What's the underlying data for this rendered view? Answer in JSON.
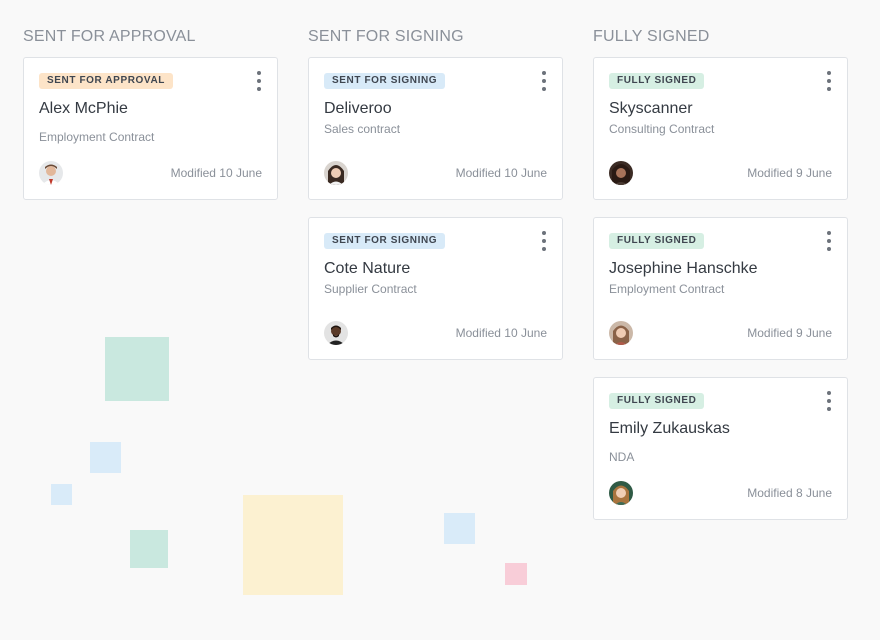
{
  "columns": [
    {
      "title": "SENT FOR APPROVAL",
      "cards": [
        {
          "status": "SENT FOR APPROVAL",
          "name": "Alex McPhie",
          "type": "Employment Contract",
          "modified": "Modified 10 June"
        }
      ]
    },
    {
      "title": "SENT FOR SIGNING",
      "cards": [
        {
          "status": "SENT FOR SIGNING",
          "name": "Deliveroo",
          "type": "Sales contract",
          "modified": "Modified 10 June"
        },
        {
          "status": "SENT FOR SIGNING",
          "name": "Cote Nature",
          "type": "Supplier Contract",
          "modified": "Modified 10 June"
        }
      ]
    },
    {
      "title": "FULLY SIGNED",
      "cards": [
        {
          "status": "FULLY SIGNED",
          "name": "Skyscanner",
          "type": "Consulting Contract",
          "modified": "Modified 9 June"
        },
        {
          "status": "FULLY SIGNED",
          "name": "Josephine Hanschke",
          "type": "Employment Contract",
          "modified": "Modified 9 June"
        },
        {
          "status": "FULLY SIGNED",
          "name": "Emily Zukauskas",
          "type": "NDA",
          "modified": "Modified 8 June"
        }
      ]
    }
  ],
  "colors": {
    "approval_badge": "#fde4c8",
    "signing_badge": "#d8eaf8",
    "signed_badge": "#d6efe3",
    "deco_green": "#c9e8df",
    "deco_blue": "#d9ebf9",
    "deco_yellow": "#fcf1d1",
    "deco_pink": "#f8cdd8"
  }
}
